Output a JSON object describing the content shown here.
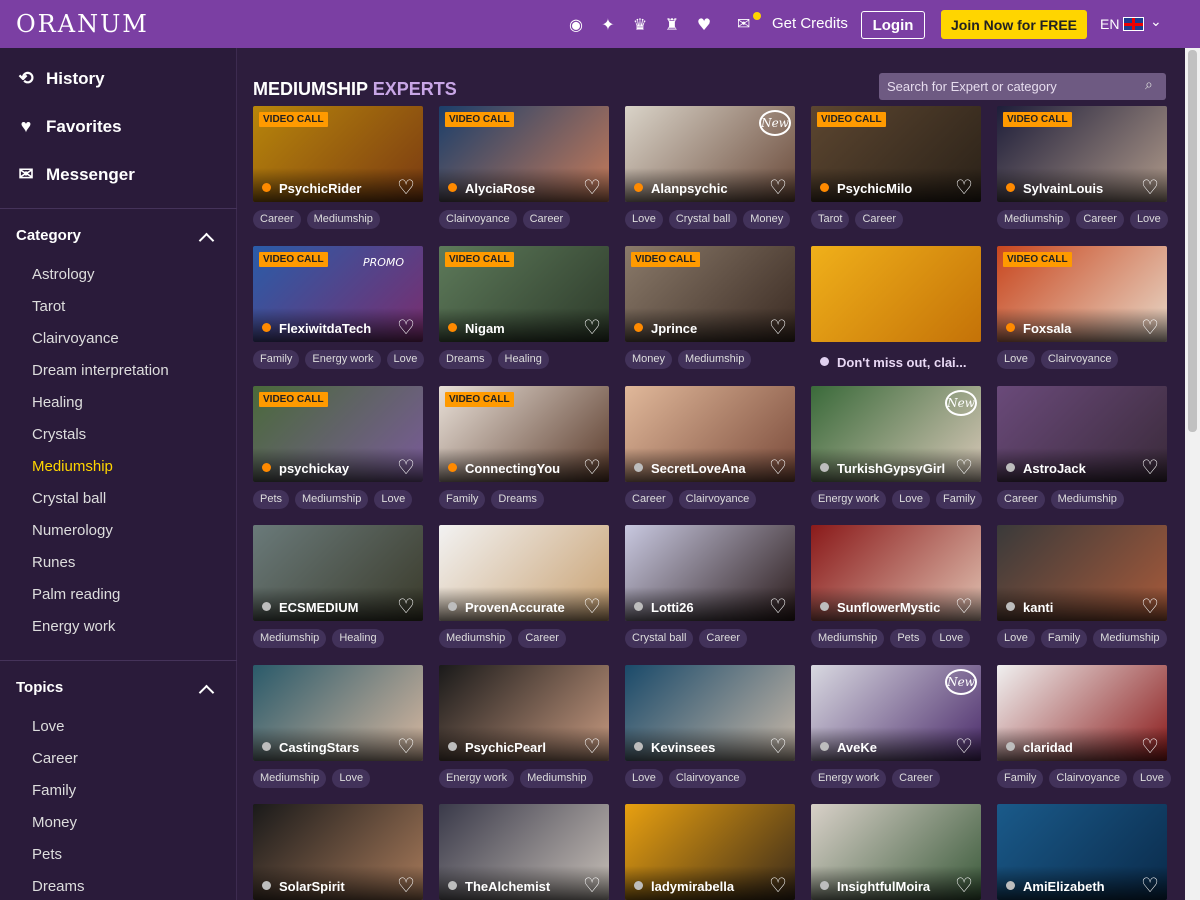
{
  "header": {
    "logo": "ORANUM",
    "get_credits": "Get Credits",
    "login": "Login",
    "join": "Join Now for FREE",
    "lang": "EN",
    "icons": [
      "webcam-icon",
      "gamepad-icon",
      "crown-icon",
      "trophy-icon",
      "heart-icon"
    ]
  },
  "sidebar": {
    "nav": [
      "History",
      "Favorites",
      "Messenger"
    ],
    "category_title": "Category",
    "categories": [
      "Astrology",
      "Tarot",
      "Clairvoyance",
      "Dream interpretation",
      "Healing",
      "Crystals",
      "Mediumship",
      "Crystal ball",
      "Numerology",
      "Runes",
      "Palm reading",
      "Energy work"
    ],
    "active_category": "Mediumship",
    "topics_title": "Topics",
    "topics": [
      "Love",
      "Career",
      "Family",
      "Money",
      "Pets",
      "Dreams"
    ]
  },
  "main": {
    "title_part1": "MEDIUMSHIP",
    "title_part2": "EXPERTS",
    "search_placeholder": "Search for Expert or category",
    "video_call_label": "VIDEO CALL",
    "new_label": "New",
    "promo_label": "PROMO",
    "promo_card_text": "Don't miss out, clai..."
  },
  "colors": {
    "header": "#7b3fa3",
    "accent_yellow": "#ffd500",
    "online": "#ff8a00",
    "offline": "#bdbdbd"
  },
  "experts": [
    {
      "name": "PsychicRider",
      "tags": [
        "Career",
        "Mediumship"
      ],
      "video": true,
      "new": false,
      "promo": false,
      "online": true,
      "c1": "#b8860b",
      "c2": "#7a3a12"
    },
    {
      "name": "AlyciaRose",
      "tags": [
        "Clairvoyance",
        "Career"
      ],
      "video": true,
      "new": false,
      "promo": false,
      "online": true,
      "c1": "#1b3e6a",
      "c2": "#c77b59"
    },
    {
      "name": "Alanpsychic",
      "tags": [
        "Love",
        "Crystal ball",
        "Money"
      ],
      "video": false,
      "new": true,
      "promo": false,
      "online": true,
      "c1": "#d9d3c8",
      "c2": "#6a4a3a"
    },
    {
      "name": "PsychicMilo",
      "tags": [
        "Tarot",
        "Career"
      ],
      "video": true,
      "new": false,
      "promo": false,
      "online": true,
      "c1": "#5c4630",
      "c2": "#2a2118"
    },
    {
      "name": "SylvainLouis",
      "tags": [
        "Mediumship",
        "Career",
        "Love"
      ],
      "video": true,
      "new": false,
      "promo": false,
      "online": true,
      "c1": "#1e1e3a",
      "c2": "#b09a8a"
    },
    {
      "name": "FlexiwitdaTech",
      "tags": [
        "Family",
        "Energy work",
        "Love"
      ],
      "video": true,
      "new": false,
      "promo": true,
      "online": true,
      "c1": "#2a5ca8",
      "c2": "#7a2d6e"
    },
    {
      "name": "Nigam",
      "tags": [
        "Dreams",
        "Healing"
      ],
      "video": true,
      "new": false,
      "promo": false,
      "online": true,
      "c1": "#5d7a5a",
      "c2": "#2d3a2a"
    },
    {
      "name": "Jprince",
      "tags": [
        "Money",
        "Mediumship"
      ],
      "video": true,
      "new": false,
      "promo": false,
      "online": true,
      "c1": "#8a7a6a",
      "c2": "#3a2a22"
    },
    {
      "name": "PROMO_SLOT",
      "tags": [],
      "video": false,
      "new": false,
      "promo": false,
      "online": false,
      "c1": "#f0b01a",
      "c2": "#c47208"
    },
    {
      "name": "Foxsala",
      "tags": [
        "Love",
        "Clairvoyance"
      ],
      "video": true,
      "new": false,
      "promo": false,
      "online": true,
      "c1": "#c8461e",
      "c2": "#e8d8c8"
    },
    {
      "name": "psychickay",
      "tags": [
        "Pets",
        "Mediumship",
        "Love"
      ],
      "video": true,
      "new": false,
      "promo": false,
      "online": true,
      "c1": "#4a6a3a",
      "c2": "#7a5a9a"
    },
    {
      "name": "ConnectingYou",
      "tags": [
        "Family",
        "Dreams"
      ],
      "video": true,
      "new": false,
      "promo": false,
      "online": true,
      "c1": "#e8e0d8",
      "c2": "#5a3a2a"
    },
    {
      "name": "SecretLoveAna",
      "tags": [
        "Career",
        "Clairvoyance"
      ],
      "video": false,
      "new": false,
      "promo": false,
      "online": false,
      "c1": "#e0b89a",
      "c2": "#7a4a3a"
    },
    {
      "name": "TurkishGypsyGirl",
      "tags": [
        "Energy work",
        "Love",
        "Family"
      ],
      "video": false,
      "new": true,
      "promo": false,
      "online": false,
      "c1": "#3a6a3a",
      "c2": "#d8c8b8"
    },
    {
      "name": "AstroJack",
      "tags": [
        "Career",
        "Mediumship"
      ],
      "video": false,
      "new": false,
      "promo": false,
      "online": false,
      "c1": "#6a4a7a",
      "c2": "#3a2a3a"
    },
    {
      "name": "ECSMEDIUM",
      "tags": [
        "Mediumship",
        "Healing"
      ],
      "video": false,
      "new": false,
      "promo": false,
      "online": false,
      "c1": "#6a7a7a",
      "c2": "#3a3a2a"
    },
    {
      "name": "ProvenAccurate",
      "tags": [
        "Mediumship",
        "Career"
      ],
      "video": false,
      "new": false,
      "promo": false,
      "online": false,
      "c1": "#f2f2f2",
      "c2": "#c8a070"
    },
    {
      "name": "Lotti26",
      "tags": [
        "Crystal ball",
        "Career"
      ],
      "video": false,
      "new": false,
      "promo": false,
      "online": false,
      "c1": "#c8c8e0",
      "c2": "#2a1a1a"
    },
    {
      "name": "SunflowerMystic",
      "tags": [
        "Mediumship",
        "Pets",
        "Love"
      ],
      "video": false,
      "new": false,
      "promo": false,
      "online": false,
      "c1": "#8a1a1a",
      "c2": "#e0c0b0"
    },
    {
      "name": "kanti",
      "tags": [
        "Love",
        "Family",
        "Mediumship"
      ],
      "video": false,
      "new": false,
      "promo": false,
      "online": false,
      "c1": "#3a3a3a",
      "c2": "#a85a3a"
    },
    {
      "name": "CastingStars",
      "tags": [
        "Mediumship",
        "Love"
      ],
      "video": false,
      "new": false,
      "promo": false,
      "online": false,
      "c1": "#2a5a6a",
      "c2": "#d8b8a0"
    },
    {
      "name": "PsychicPearl",
      "tags": [
        "Energy work",
        "Mediumship"
      ],
      "video": false,
      "new": false,
      "promo": false,
      "online": false,
      "c1": "#1a1a1a",
      "c2": "#c89a80"
    },
    {
      "name": "Kevinsees",
      "tags": [
        "Love",
        "Clairvoyance"
      ],
      "video": false,
      "new": false,
      "promo": false,
      "online": false,
      "c1": "#1a4a6a",
      "c2": "#c8b8a8"
    },
    {
      "name": "AveKe",
      "tags": [
        "Energy work",
        "Career"
      ],
      "video": false,
      "new": true,
      "promo": false,
      "online": false,
      "c1": "#d8d8e0",
      "c2": "#4a2a6a"
    },
    {
      "name": "claridad",
      "tags": [
        "Family",
        "Clairvoyance",
        "Love"
      ],
      "video": false,
      "new": false,
      "promo": false,
      "online": false,
      "c1": "#f0f0f0",
      "c2": "#8a1a1a"
    },
    {
      "name": "SolarSpirit",
      "tags": [],
      "video": false,
      "new": false,
      "promo": false,
      "online": false,
      "c1": "#1a1a1a",
      "c2": "#a87a5a"
    },
    {
      "name": "TheAlchemist",
      "tags": [],
      "video": false,
      "new": false,
      "promo": false,
      "online": false,
      "c1": "#3a3a4a",
      "c2": "#c8c0b8"
    },
    {
      "name": "ladymirabella",
      "tags": [],
      "video": false,
      "new": false,
      "promo": false,
      "online": false,
      "c1": "#e8a010",
      "c2": "#3a2a1a"
    },
    {
      "name": "InsightfulMoira",
      "tags": [],
      "video": false,
      "new": false,
      "promo": false,
      "online": false,
      "c1": "#d8d0c8",
      "c2": "#3a5a3a"
    },
    {
      "name": "AmiElizabeth",
      "tags": [],
      "video": false,
      "new": false,
      "promo": false,
      "online": false,
      "c1": "#1a5a8a",
      "c2": "#0a2a4a"
    }
  ]
}
